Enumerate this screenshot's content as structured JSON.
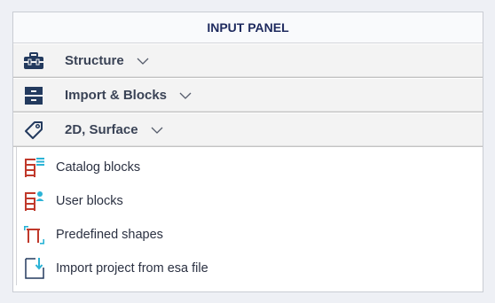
{
  "panel": {
    "title": "INPUT PANEL",
    "sections": [
      {
        "label": "Structure",
        "icon": "toolbox-icon"
      },
      {
        "label": "Import & Blocks",
        "icon": "cabinet-icon"
      },
      {
        "label": "2D, Surface",
        "icon": "tag-icon"
      }
    ],
    "items": [
      {
        "label": "Catalog blocks",
        "icon": "catalog-blocks-icon"
      },
      {
        "label": "User blocks",
        "icon": "user-blocks-icon"
      },
      {
        "label": "Predefined shapes",
        "icon": "predefined-shapes-icon"
      },
      {
        "label": "Import project from esa file",
        "icon": "import-file-icon"
      }
    ]
  },
  "colors": {
    "title": "#1e2a5e",
    "icon_dark": "#233a5e",
    "icon_red": "#c0392b",
    "icon_cyan": "#2bb3d6"
  }
}
